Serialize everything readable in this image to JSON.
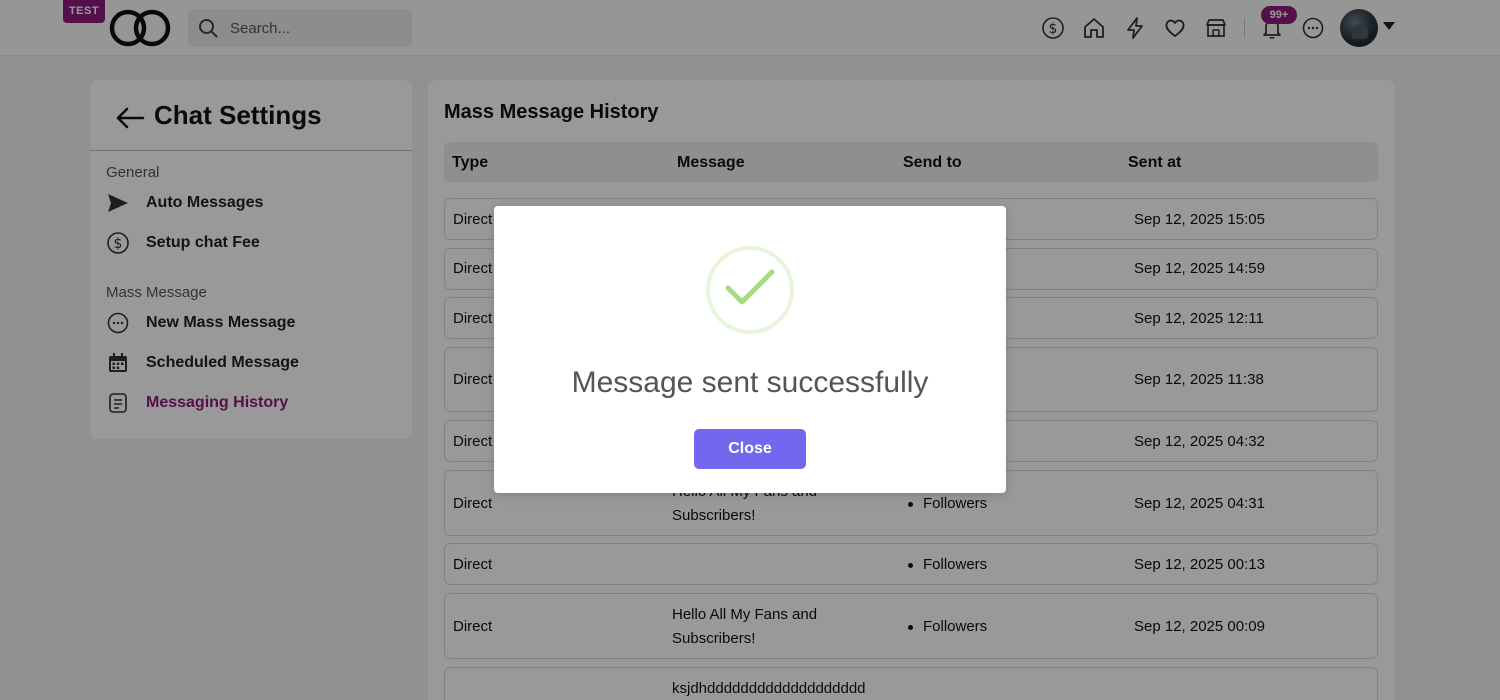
{
  "topbar": {
    "env_badge": "TEST",
    "search_placeholder": "Search...",
    "notif_count": "99+"
  },
  "sidebar": {
    "title": "Chat Settings",
    "sections": [
      {
        "label": "General",
        "items": [
          {
            "label": "Auto Messages",
            "icon": "send-icon"
          },
          {
            "label": "Setup chat Fee",
            "icon": "dollar-icon"
          }
        ]
      },
      {
        "label": "Mass Message",
        "items": [
          {
            "label": "New Mass Message",
            "icon": "chat-bubble-icon"
          },
          {
            "label": "Scheduled Message",
            "icon": "calendar-icon"
          },
          {
            "label": "Messaging History",
            "icon": "document-icon",
            "active": true
          }
        ]
      }
    ],
    "accent_color": "#8e1b7e"
  },
  "main": {
    "title": "Mass Message History",
    "columns": [
      "Type",
      "Message",
      "Send to",
      "Sent at"
    ],
    "rows": [
      {
        "type": "Direct",
        "message": "",
        "send_to": "",
        "sent_at": "Sep 12, 2025 15:05"
      },
      {
        "type": "Direct",
        "message": "",
        "send_to": "",
        "sent_at": "Sep 12, 2025 14:59"
      },
      {
        "type": "Direct",
        "message": "",
        "send_to": "",
        "sent_at": "Sep 12, 2025 12:11"
      },
      {
        "type": "Direct",
        "message": "",
        "send_to": "",
        "sent_at": "Sep 12, 2025 11:38"
      },
      {
        "type": "Direct",
        "message": "",
        "send_to": "",
        "sent_at": "Sep 12, 2025 04:32"
      },
      {
        "type": "Direct",
        "message_line1": "Hello All My Fans and",
        "message_line2": "Subscribers!",
        "send_to": "Followers",
        "sent_at": "Sep 12, 2025 04:31"
      },
      {
        "type": "Direct",
        "message": "",
        "send_to": "Followers",
        "sent_at": "Sep 12, 2025 00:13"
      },
      {
        "type": "Direct",
        "message_line1": "Hello All My Fans and",
        "message_line2": "Subscribers!",
        "send_to": "Followers",
        "sent_at": "Sep 12, 2025 00:09"
      },
      {
        "type": "",
        "message_line1": "ksjdhddddddddddddddddddd",
        "send_to": "",
        "sent_at": ""
      }
    ]
  },
  "modal": {
    "message": "Message sent successfully",
    "close_label": "Close",
    "button_color": "#7367f0",
    "check_color": "#a5dc86"
  }
}
